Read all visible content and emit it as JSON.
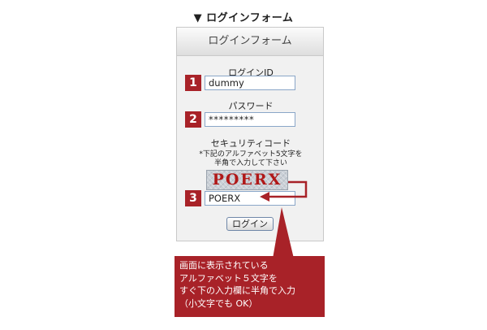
{
  "section_heading": "▼ ログインフォーム",
  "panel": {
    "title": "ログインフォーム",
    "id_label": "ログインID",
    "id_value": "dummy",
    "password_label": "パスワード",
    "password_value": "*********",
    "security_label": "セキュリティコード",
    "security_note_line1": "*下記のアルファベット5文字を",
    "security_note_line2": "半角で入力して下さい",
    "captcha_text": "POERX",
    "security_value": "POERX",
    "login_button": "ログイン"
  },
  "steps": [
    "1",
    "2",
    "3"
  ],
  "callout": {
    "lines": [
      "画面に表示されている",
      "アルファベット５文字を",
      "すぐ下の入力欄に半角で入力",
      "（小文字でも OK）"
    ]
  },
  "colors": {
    "accent_red": "#a82228",
    "captcha_text": "#b01818",
    "input_border": "#8aa6c8"
  }
}
